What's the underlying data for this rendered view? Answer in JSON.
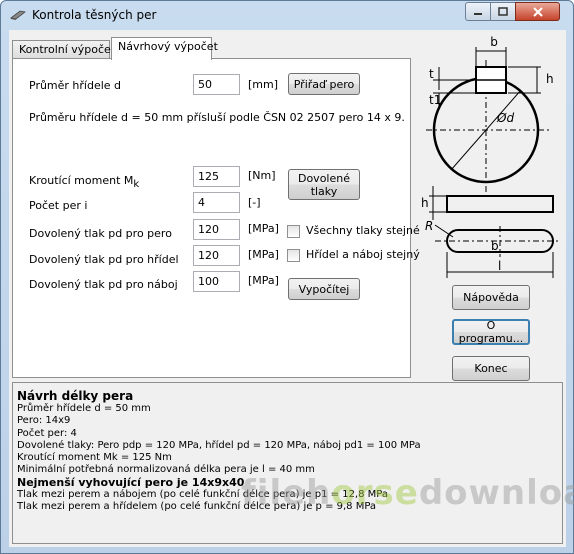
{
  "window": {
    "title": "Kontrola těsných per"
  },
  "tabs": [
    {
      "label": "Kontrolní výpočet"
    },
    {
      "label": "Návrhový výpočet"
    }
  ],
  "form": {
    "shaft_label": "Průměr hřídele d",
    "shaft_value": "50",
    "shaft_unit": "[mm]",
    "assign_button": "Přiřaď pero",
    "norm_text": "Průměru hřídele d = 50 mm přísluší podle ČSN 02 2507 pero 14 x 9.",
    "torque_label": "Kroutící moment M",
    "torque_sub": "k",
    "torque_value": "125",
    "torque_unit": "[Nm]",
    "count_label": "Počet per i",
    "count_value": "4",
    "count_unit": "[-]",
    "allowed_button_line1": "Dovolené",
    "allowed_button_line2": "tlaky",
    "p_key_label": "Dovolený tlak pd pro pero",
    "p_key_value": "120",
    "p_key_unit": "[MPa]",
    "p_shaft_label": "Dovolený tlak pd pro hřídel",
    "p_shaft_value": "120",
    "p_shaft_unit": "[MPa]",
    "p_hub_label": "Dovolený tlak pd pro náboj",
    "p_hub_value": "100",
    "p_hub_unit": "[MPa]",
    "all_same_label": "Všechny tlaky stejné",
    "shaft_hub_same_label": "Hřídel a náboj stejný",
    "compute_button": "Vypočítej"
  },
  "diagram": {
    "b": "b",
    "h": "h",
    "t": "t",
    "t1": "t1",
    "d": "Ød",
    "R": "R",
    "l": "l"
  },
  "side_buttons": {
    "help": "Nápověda",
    "about": "O programu...",
    "end": "Konec"
  },
  "result": {
    "heading": "Návrh délky pera",
    "lines1": [
      "Průměr hřídele d = 50 mm",
      "Pero: 14x9",
      "Počet per: 4",
      "Dovolené tlaky: Pero pdp = 120 MPa, hřídel pd = 120 MPa, náboj pd1 = 100 MPa",
      "Kroutící moment Mk = 125 Nm",
      "Minimální potřebná normalizovaná délka pera je l = 40 mm"
    ],
    "bold_line": "Nejmenší vyhovující pero je 14x9x40",
    "lines2": [
      "Tlak mezi perem a nábojem (po celé funkční délce pera) je p1 = 12,8 MPa",
      "Tlak mezi perem a hřídelem (po celé funkční délce pera) je p = 9,8 MPa"
    ]
  },
  "watermark": {
    "part1": "fileh",
    "part2": "orse",
    "part3": "download.com"
  }
}
